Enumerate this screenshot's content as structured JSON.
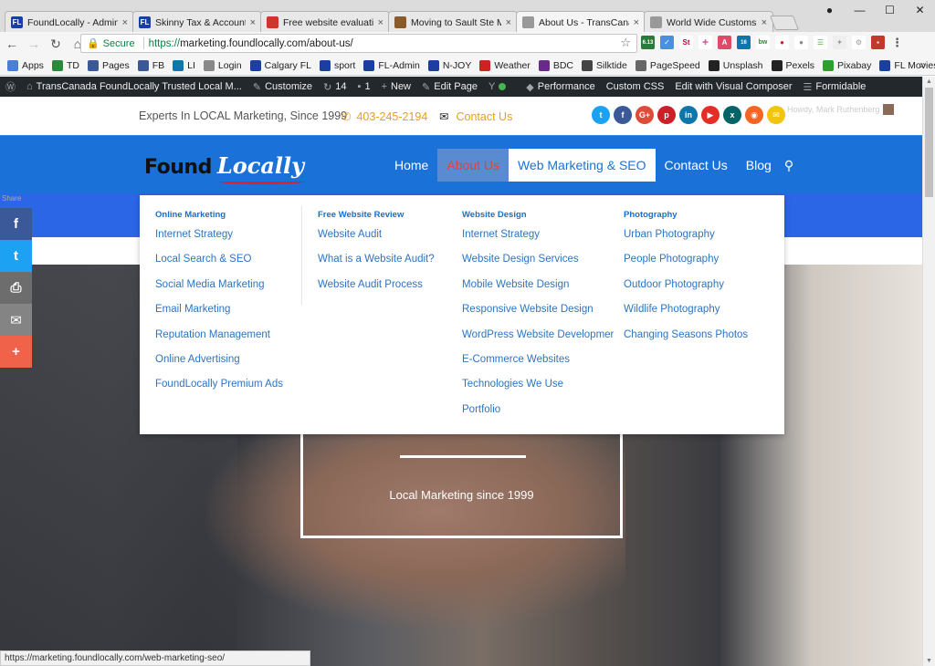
{
  "browser": {
    "tabs": [
      {
        "title": "FoundLocally - Admin - A",
        "icon": "FL",
        "color": "#1a3fa0",
        "active": false
      },
      {
        "title": "Skinny Tax & Accounting",
        "icon": "FL",
        "color": "#1a3fa0",
        "active": false
      },
      {
        "title": "Free website evaluation",
        "icon": "",
        "color": "#d0342c",
        "active": false
      },
      {
        "title": "Moving to Sault Ste Mar",
        "icon": "",
        "color": "#8a5a2a",
        "active": false
      },
      {
        "title": "About Us - TransCanada",
        "icon": "",
        "color": "#999999",
        "active": true
      },
      {
        "title": "World Wide Customs Bro",
        "icon": "",
        "color": "#999999",
        "active": false
      }
    ],
    "address": {
      "secure_label": "Secure",
      "scheme": "https://",
      "host": "marketing.foundlocally.com",
      "path": "/about-us/"
    },
    "extension_badges": [
      "6.13",
      "St",
      "A",
      "16",
      "bw"
    ],
    "bookmarks": [
      {
        "label": "Apps",
        "color": "#4a7fd8"
      },
      {
        "label": "TD",
        "color": "#2a8a3a"
      },
      {
        "label": "Pages",
        "color": "#3b5998"
      },
      {
        "label": "FB",
        "color": "#3b5998"
      },
      {
        "label": "LI",
        "color": "#0e76a8"
      },
      {
        "label": "Login",
        "color": "#888888"
      },
      {
        "label": "Calgary FL",
        "color": "#1a3fa0"
      },
      {
        "label": "sport",
        "color": "#1a3fa0"
      },
      {
        "label": "FL-Admin",
        "color": "#1a3fa0"
      },
      {
        "label": "N-JOY",
        "color": "#1a3fa0"
      },
      {
        "label": "Weather",
        "color": "#cc2222"
      },
      {
        "label": "BDC",
        "color": "#6a2a8a"
      },
      {
        "label": "Silktide",
        "color": "#444444"
      },
      {
        "label": "PageSpeed",
        "color": "#666666"
      },
      {
        "label": "Unsplash",
        "color": "#222222"
      },
      {
        "label": "Pexels",
        "color": "#222222"
      },
      {
        "label": "Pixabay",
        "color": "#2ea02e"
      },
      {
        "label": "FL Movies",
        "color": "#1a3fa0"
      }
    ]
  },
  "wpbar": {
    "site": "TransCanada FoundLocally Trusted Local M...",
    "customize": "Customize",
    "updates": "14",
    "comments": "1",
    "new": "New",
    "edit_page": "Edit Page",
    "performance": "Performance",
    "custom_css": "Custom CSS",
    "visual_composer": "Edit with Visual Composer",
    "formidable": "Formidable"
  },
  "topbar": {
    "tagline": "Experts In LOCAL Marketing, Since 1999",
    "phone": "403-245-2194",
    "contact": "Contact Us",
    "howdy": "Howdy, Mark Ruthenberg"
  },
  "social": [
    {
      "name": "twitter",
      "color": "#1da1f2",
      "glyph": "t"
    },
    {
      "name": "facebook",
      "color": "#3b5998",
      "glyph": "f"
    },
    {
      "name": "google-plus",
      "color": "#dd4b39",
      "glyph": "G+"
    },
    {
      "name": "pinterest",
      "color": "#cb2027",
      "glyph": "p"
    },
    {
      "name": "linkedin",
      "color": "#0e76a8",
      "glyph": "in"
    },
    {
      "name": "youtube",
      "color": "#e52d27",
      "glyph": "▶"
    },
    {
      "name": "xing",
      "color": "#026466",
      "glyph": "x"
    },
    {
      "name": "rss",
      "color": "#f26522",
      "glyph": "◉"
    },
    {
      "name": "email",
      "color": "#f1c40f",
      "glyph": "✉"
    }
  ],
  "logo": {
    "found": "Found",
    "locally": "Locally"
  },
  "nav": {
    "home": "Home",
    "about": "About Us",
    "web_marketing": "Web Marketing & SEO",
    "contact": "Contact Us",
    "blog": "Blog"
  },
  "share": {
    "label": "Share"
  },
  "mega_menu": {
    "columns": [
      {
        "heading": "Online Marketing",
        "links": [
          "Internet Strategy",
          "Local Search & SEO",
          "Social Media Marketing",
          "Email Marketing",
          "Reputation Management",
          "Online Advertising",
          "FoundLocally Premium Ads"
        ]
      },
      {
        "heading": "Free Website Review",
        "links": [
          "Website Audit",
          "What is a Website Audit?",
          "Website Audit Process"
        ]
      },
      {
        "heading": "Website Design",
        "links": [
          "Internet Strategy",
          "Website Design Services",
          "Mobile Website Design",
          "Responsive Website Design",
          "WordPress Website Developmer",
          "E-Commerce Websites",
          "Technologies We Use",
          "Portfolio"
        ]
      },
      {
        "heading": "Photography",
        "links": [
          "Urban Photography",
          "People Photography",
          "Outdoor Photography",
          "Wildlife Photography",
          "Changing Seasons Photos"
        ]
      }
    ]
  },
  "hero": {
    "text": "Local Marketing since 1999"
  },
  "status_url": "https://marketing.foundlocally.com/web-marketing-seo/"
}
